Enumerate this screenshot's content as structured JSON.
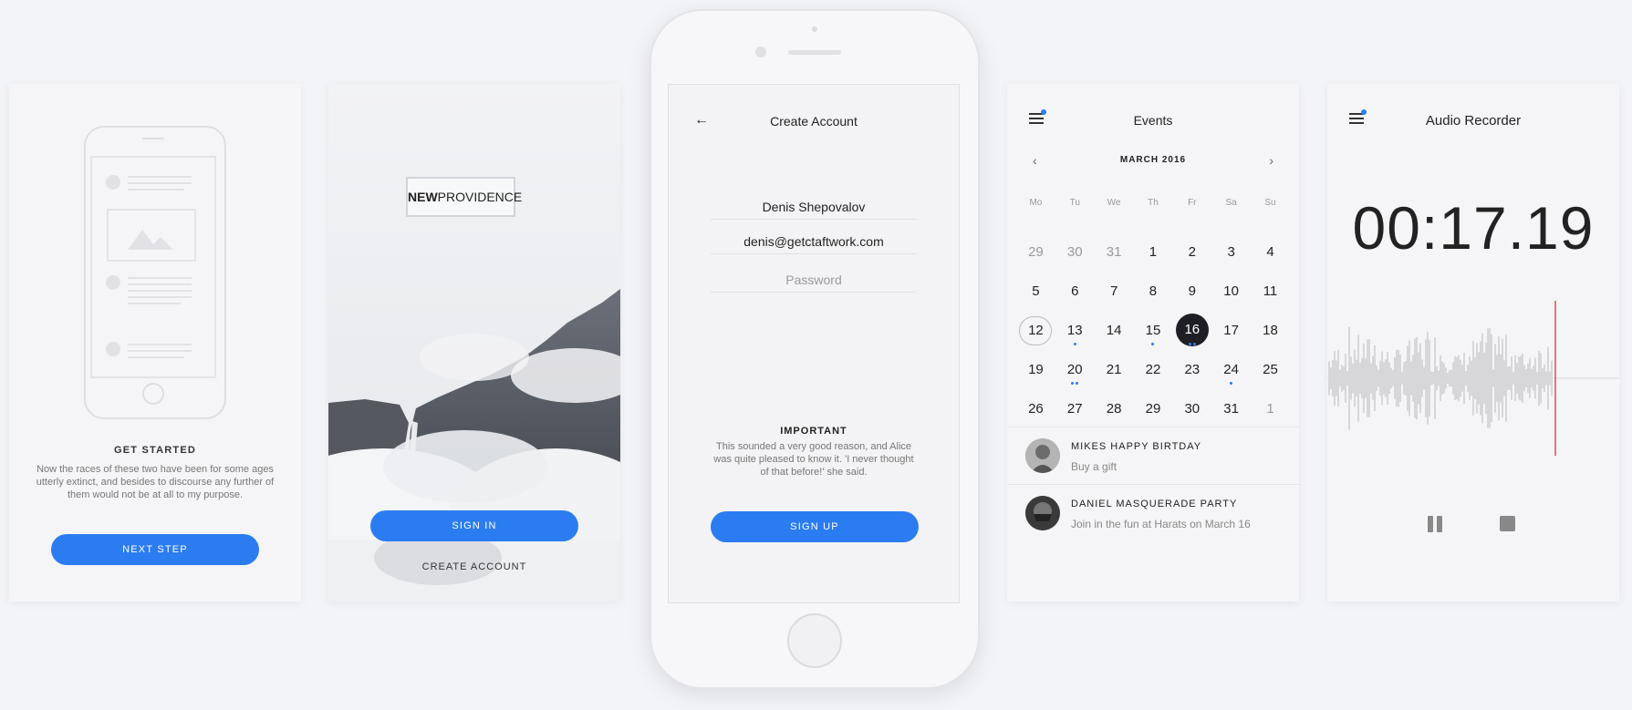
{
  "onboarding": {
    "title": "GET STARTED",
    "body": "Now the races of these two have been for some ages utterly extinct, and besides to discourse any further of them would not be at all to my purpose.",
    "button": "NEXT STEP"
  },
  "welcome": {
    "logo_bold": "NEW",
    "logo_light": "PROVIDENCE",
    "sign_in": "SIGN IN",
    "create_account": "CREATE ACCOUNT"
  },
  "signup": {
    "title": "Create Account",
    "name_value": "Denis Shepovalov",
    "email_value": "denis@getctaftwork.com",
    "password_placeholder": "Password",
    "notice_title": "IMPORTANT",
    "notice_body": "This sounded a very good reason, and Alice was quite pleased to know it. 'I never thought of that before!' she said.",
    "button": "SIGN UP"
  },
  "events": {
    "title": "Events",
    "month": "MARCH 2016",
    "weekdays": [
      "Mo",
      "Tu",
      "We",
      "Th",
      "Fr",
      "Sa",
      "Su"
    ],
    "weeks": [
      [
        {
          "d": "29",
          "m": 1
        },
        {
          "d": "30",
          "m": 1
        },
        {
          "d": "31",
          "m": 1
        },
        {
          "d": "1"
        },
        {
          "d": "2"
        },
        {
          "d": "3"
        },
        {
          "d": "4"
        }
      ],
      [
        {
          "d": "5"
        },
        {
          "d": "6"
        },
        {
          "d": "7"
        },
        {
          "d": "8"
        },
        {
          "d": "9"
        },
        {
          "d": "10"
        },
        {
          "d": "11"
        }
      ],
      [
        {
          "d": "12",
          "today": 1
        },
        {
          "d": "13",
          "dots": 1
        },
        {
          "d": "14"
        },
        {
          "d": "15",
          "dots": 1
        },
        {
          "d": "16",
          "sel": 1,
          "dots": 2
        },
        {
          "d": "17"
        },
        {
          "d": "18"
        }
      ],
      [
        {
          "d": "19"
        },
        {
          "d": "20",
          "dots": 2
        },
        {
          "d": "21"
        },
        {
          "d": "22"
        },
        {
          "d": "23"
        },
        {
          "d": "24",
          "dots": 1
        },
        {
          "d": "25"
        }
      ],
      [
        {
          "d": "26"
        },
        {
          "d": "27"
        },
        {
          "d": "28"
        },
        {
          "d": "29"
        },
        {
          "d": "30"
        },
        {
          "d": "31"
        },
        {
          "d": "1",
          "m": 1
        }
      ]
    ],
    "items": [
      {
        "title": "MIKES HAPPY BIRTDAY",
        "subtitle": "Buy a gift"
      },
      {
        "title": "DANIEL MASQUERADE PARTY",
        "subtitle": "Join in the fun at Harats on March 16"
      }
    ]
  },
  "recorder": {
    "title": "Audio Recorder",
    "timer": "00:17.19"
  },
  "colors": {
    "accent": "#2b7cf0",
    "selected": "#1e1f24",
    "background": "#f3f4f8"
  }
}
